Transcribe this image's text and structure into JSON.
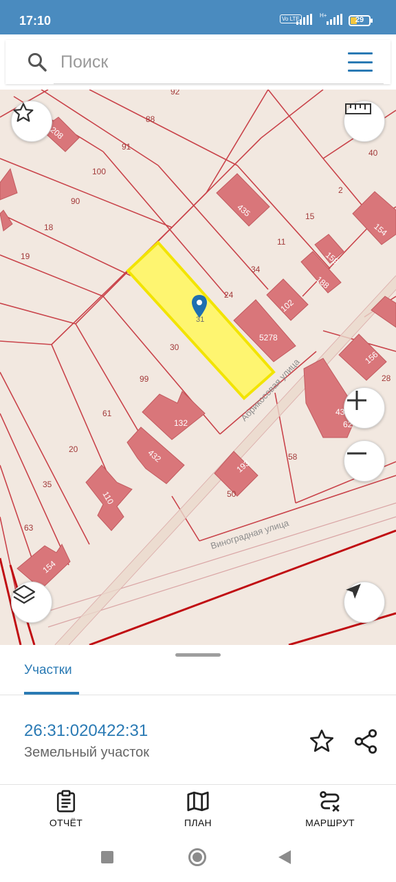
{
  "status_bar": {
    "time": "17:10",
    "volte_label": "Vo LTE",
    "network_label": "H+",
    "battery_percent": "29"
  },
  "search": {
    "placeholder": "Поиск"
  },
  "map": {
    "selected_parcel_label": "31",
    "parcel_labels": [
      "92",
      "88",
      "208",
      "91",
      "100",
      "90",
      "18",
      "19",
      "40",
      "2",
      "15",
      "11",
      "34",
      "24",
      "30",
      "99",
      "61",
      "20",
      "35",
      "63",
      "28",
      "58",
      "50"
    ],
    "building_labels": [
      "435",
      "154",
      "159",
      "188",
      "102",
      "5278",
      "156",
      "132",
      "432",
      "110",
      "193",
      "154",
      "43",
      "62"
    ],
    "street_labels": [
      "Абрикосовая улица",
      "Виноградная улица"
    ],
    "colors": {
      "background": "#f2e8e0",
      "parcel_border": "#c0392b",
      "building_fill": "#d9767a",
      "selected_fill": "#fff566",
      "selected_border": "#f2e400",
      "marker": "#1f6fb0"
    }
  },
  "sheet": {
    "tab_label": "Участки",
    "parcel_id": "26:31:020422:31",
    "parcel_type": "Земельный участок",
    "actions": {
      "report": "ОТЧЁТ",
      "plan": "ПЛАН",
      "route": "МАРШРУТ"
    }
  },
  "accent_color": "#2a7ab4",
  "status_bar_color": "#4a8bbf"
}
